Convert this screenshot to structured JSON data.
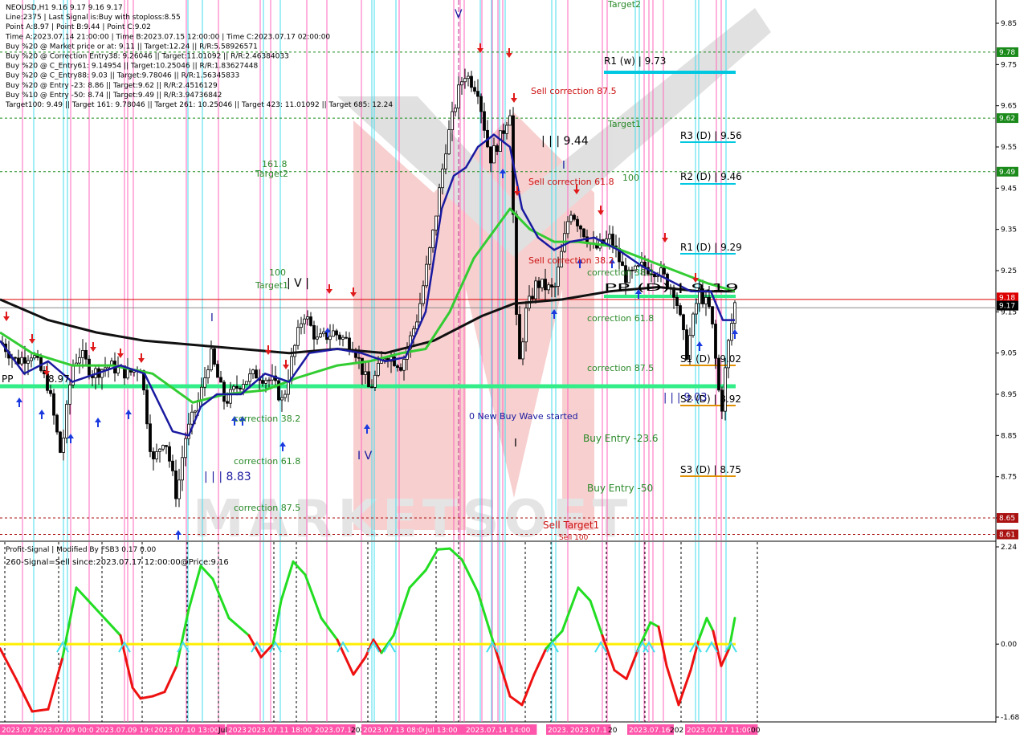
{
  "header": {
    "lines": [
      "NEOUSD,H1  9.16 9.17 9.16 9.17",
      "Line:2375 | Last Signal is:Buy with stoploss:8.55",
      "Point A:8.97 | Point B:9.44 | Point C:9.02",
      "Time A:2023.07.14 21:00:00 | Time B:2023.07.15 12:00:00 | Time C:2023.07.17 02:00:00",
      "Buy %20 @ Market price or at: 9.11 || Target:12.24 || R/R:5.58926571",
      "Buy %20 @ Correction Entry38: 9.26046 || Target:11.01092 || R/R:2.46384033",
      "Buy %20 @ C_Entry61: 9.14954 || Target:10.25046 || R/R:1.83627448",
      "Buy %20 @ C_Entry88: 9.03 || Target:9.78046 || R/R:1.56345833",
      "Buy %20 @ Entry -23: 8.86 || Target:9.62 || R/R:2.4516129",
      "Buy %10 @ Entry -50: 8.74 || Target:9.49 || R/R:3.94736842",
      "Target100: 9.49 || Target 161: 9.78046 || Target 261: 10.25046 || Target 423: 11.01092 || Target 685: 12.24"
    ]
  },
  "price_axis": {
    "ticks": [
      "9.85",
      "9.75",
      "9.65",
      "9.55",
      "9.45",
      "9.35",
      "9.25",
      "9.15",
      "9.05",
      "8.95",
      "8.85",
      "8.75",
      "8.65"
    ],
    "tags": [
      {
        "label": "9.78",
        "color": "#1a8a1a"
      },
      {
        "label": "9.62",
        "color": "#1a8a1a"
      },
      {
        "label": "9.49",
        "color": "#1a8a1a"
      },
      {
        "label": "9.18",
        "color": "#dd0000"
      },
      {
        "label": "9.17",
        "color": "#000000"
      },
      {
        "label": "8.65",
        "color": "#aa1111"
      },
      {
        "label": "8.61",
        "color": "#aa1111"
      }
    ]
  },
  "osc_axis": {
    "ticks": [
      "2.24",
      "0.00",
      "-1.68"
    ]
  },
  "time_axis": {
    "labels": [
      "2023.07.08",
      "2023.07.09 00:00",
      "2023.07.09 19:00",
      "2023.07.10 13:00",
      "Jul",
      "2023.07",
      "2023.07.11 18:00",
      "2023.07.1",
      "202",
      "2023.07.13 08:00",
      "Jul 13:00",
      "2023.07.14 14:00",
      "2023.07.15",
      "2023.07.1",
      "20",
      "2023.07.16",
      "202",
      "2023.07.17 11:00",
      ":00"
    ]
  },
  "levels": {
    "r1w": "R1 (w) | 9.73",
    "r3": "R3 (D) | 9.56",
    "r2": "R2 (D) | 9.46",
    "r1": "R1 (D) | 9.29",
    "pp": "PP (D) | 9.19",
    "s1": "S1 (D) | 9.02",
    "s2": "S2 (D) | 8.92",
    "s3": "S3 (D) | 8.75",
    "pp_left": "PP",
    "pp_left_val": "8.97"
  },
  "annotations": {
    "target2_top": "Target2",
    "target1_mid": "Target1",
    "n161": "161.8",
    "target2_left": "Target2",
    "n100_left": "100",
    "target1_left": "Target1",
    "wave_iiii": "| | | 9.44",
    "wave_iii": "| | | 8.83",
    "wave_iv": "I V",
    "wave_v": "V",
    "wave_ivi": "| V |",
    "wave_i": "I",
    "wave_iii_b": "| | | 9.03",
    "n100_mid": "100",
    "sell_corr_875": "Sell correction 87.5",
    "sell_corr_618": "Sell correction 61.8",
    "sell_corr_382": "Sell correction 38.2",
    "corr_382_mid": "correction 38.2",
    "corr_618_mid": "correction 61.8",
    "corr_875_mid": "correction 87.5",
    "corr_382_left": "correction 38.2",
    "corr_618_left": "correction 61.8",
    "corr_875_left": "correction 87.5",
    "new_wave": "0 New Buy Wave started",
    "buy_entry_23": "Buy Entry -23.6",
    "buy_entry_50": "Buy Entry -50",
    "sell_target1": "Sell Target1",
    "sell_100": "Sell 100"
  },
  "oscillator": {
    "title": "Profit-Signal | Modified By FSB3 0.17 0.00",
    "signal": "260-Signal=Sell since:2023.07.17 12:00:00@Price:9.16"
  },
  "colors": {
    "ma_fast": "#1a1aa0",
    "ma_slow": "#33cc33",
    "ma_200": "#111111",
    "pivot": "#00c8e0",
    "support": "#e09000",
    "bull_osc": "#22dd22",
    "bear_osc": "#ee1111",
    "pink_vline": "#ff66bb",
    "cyan_vline": "#44ddee"
  },
  "chart_data": [
    {
      "type": "candlestick",
      "title": "NEOUSD,H1",
      "ylim": [
        8.6,
        9.88
      ],
      "ohlc_path": [
        [
          0,
          9.08
        ],
        [
          20,
          9.03
        ],
        [
          40,
          9.05
        ],
        [
          60,
          8.97
        ],
        [
          76,
          8.8
        ],
        [
          90,
          9.02
        ],
        [
          100,
          9.05
        ],
        [
          115,
          9.0
        ],
        [
          135,
          9.02
        ],
        [
          160,
          9.0
        ],
        [
          175,
          9.02
        ],
        [
          190,
          8.78
        ],
        [
          205,
          8.85
        ],
        [
          220,
          8.7
        ],
        [
          230,
          8.84
        ],
        [
          250,
          8.95
        ],
        [
          262,
          9.05
        ],
        [
          280,
          8.93
        ],
        [
          300,
          8.98
        ],
        [
          320,
          9.0
        ],
        [
          340,
          8.98
        ],
        [
          352,
          8.93
        ],
        [
          365,
          9.05
        ],
        [
          378,
          9.15
        ],
        [
          395,
          9.08
        ],
        [
          415,
          9.1
        ],
        [
          440,
          9.07
        ],
        [
          460,
          8.96
        ],
        [
          480,
          9.05
        ],
        [
          500,
          9.02
        ],
        [
          520,
          9.14
        ],
        [
          540,
          9.35
        ],
        [
          555,
          9.55
        ],
        [
          570,
          9.68
        ],
        [
          578,
          9.73
        ],
        [
          595,
          9.69
        ],
        [
          610,
          9.52
        ],
        [
          625,
          9.58
        ],
        [
          635,
          9.64
        ],
        [
          645,
          9.0
        ],
        [
          655,
          9.15
        ],
        [
          668,
          9.22
        ],
        [
          690,
          9.2
        ],
        [
          710,
          9.4
        ],
        [
          725,
          9.35
        ],
        [
          740,
          9.3
        ],
        [
          760,
          9.33
        ],
        [
          780,
          9.23
        ],
        [
          800,
          9.26
        ],
        [
          820,
          9.25
        ],
        [
          840,
          9.2
        ],
        [
          855,
          9.05
        ],
        [
          870,
          9.2
        ],
        [
          885,
          9.15
        ],
        [
          898,
          8.9
        ],
        [
          905,
          9.05
        ],
        [
          915,
          9.17
        ]
      ],
      "ma_fast": [
        [
          0,
          9.08
        ],
        [
          30,
          9.0
        ],
        [
          60,
          9.03
        ],
        [
          90,
          8.98
        ],
        [
          120,
          9.0
        ],
        [
          150,
          9.02
        ],
        [
          180,
          9.0
        ],
        [
          200,
          8.92
        ],
        [
          215,
          8.86
        ],
        [
          235,
          8.85
        ],
        [
          250,
          8.92
        ],
        [
          270,
          8.95
        ],
        [
          300,
          8.95
        ],
        [
          330,
          9.0
        ],
        [
          360,
          8.98
        ],
        [
          385,
          9.05
        ],
        [
          420,
          9.06
        ],
        [
          450,
          9.05
        ],
        [
          480,
          9.03
        ],
        [
          505,
          9.04
        ],
        [
          530,
          9.15
        ],
        [
          550,
          9.4
        ],
        [
          565,
          9.48
        ],
        [
          580,
          9.5
        ],
        [
          595,
          9.55
        ],
        [
          615,
          9.58
        ],
        [
          635,
          9.55
        ],
        [
          650,
          9.4
        ],
        [
          670,
          9.33
        ],
        [
          690,
          9.3
        ],
        [
          710,
          9.32
        ],
        [
          740,
          9.33
        ],
        [
          770,
          9.3
        ],
        [
          800,
          9.26
        ],
        [
          830,
          9.23
        ],
        [
          860,
          9.2
        ],
        [
          885,
          9.2
        ],
        [
          900,
          9.13
        ],
        [
          915,
          9.13
        ]
      ],
      "ma_slow": [
        [
          0,
          9.1
        ],
        [
          40,
          9.05
        ],
        [
          90,
          9.02
        ],
        [
          140,
          9.02
        ],
        [
          190,
          9.0
        ],
        [
          240,
          8.93
        ],
        [
          280,
          8.95
        ],
        [
          330,
          8.96
        ],
        [
          370,
          8.99
        ],
        [
          420,
          9.02
        ],
        [
          460,
          9.03
        ],
        [
          500,
          9.05
        ],
        [
          530,
          9.06
        ],
        [
          560,
          9.15
        ],
        [
          590,
          9.28
        ],
        [
          620,
          9.36
        ],
        [
          635,
          9.4
        ],
        [
          660,
          9.35
        ],
        [
          690,
          9.32
        ],
        [
          720,
          9.32
        ],
        [
          760,
          9.31
        ],
        [
          800,
          9.28
        ],
        [
          840,
          9.25
        ],
        [
          880,
          9.22
        ],
        [
          915,
          9.2
        ]
      ],
      "ma_200": [
        [
          0,
          9.18
        ],
        [
          60,
          9.13
        ],
        [
          120,
          9.1
        ],
        [
          180,
          9.08
        ],
        [
          240,
          9.07
        ],
        [
          300,
          9.06
        ],
        [
          360,
          9.05
        ],
        [
          420,
          9.06
        ],
        [
          480,
          9.05
        ],
        [
          540,
          9.08
        ],
        [
          600,
          9.14
        ],
        [
          640,
          9.17
        ],
        [
          700,
          9.18
        ],
        [
          760,
          9.2
        ],
        [
          820,
          9.21
        ],
        [
          870,
          9.2
        ],
        [
          915,
          9.2
        ]
      ],
      "oscillator": {
        "ylim": [
          -1.68,
          2.24
        ],
        "path": [
          [
            0,
            -0.1
          ],
          [
            20,
            -0.8
          ],
          [
            40,
            -1.55
          ],
          [
            60,
            -1.5
          ],
          [
            78,
            -0.3
          ],
          [
            95,
            1.3
          ],
          [
            110,
            1.0
          ],
          [
            130,
            0.6
          ],
          [
            150,
            0.2
          ],
          [
            165,
            -1.0
          ],
          [
            175,
            -1.25
          ],
          [
            190,
            -1.2
          ],
          [
            205,
            -1.1
          ],
          [
            220,
            -0.5
          ],
          [
            235,
            0.8
          ],
          [
            250,
            1.8
          ],
          [
            265,
            1.5
          ],
          [
            285,
            0.6
          ],
          [
            310,
            0.2
          ],
          [
            325,
            -0.3
          ],
          [
            340,
            0.0
          ],
          [
            350,
            1.0
          ],
          [
            365,
            1.9
          ],
          [
            380,
            1.6
          ],
          [
            400,
            0.6
          ],
          [
            420,
            0.1
          ],
          [
            440,
            -0.7
          ],
          [
            455,
            -0.3
          ],
          [
            465,
            0.1
          ],
          [
            475,
            -0.2
          ],
          [
            490,
            0.2
          ],
          [
            510,
            1.3
          ],
          [
            530,
            1.7
          ],
          [
            545,
            2.18
          ],
          [
            560,
            2.2
          ],
          [
            575,
            1.95
          ],
          [
            595,
            1.2
          ],
          [
            615,
            0.0
          ],
          [
            635,
            -1.2
          ],
          [
            650,
            -1.4
          ],
          [
            665,
            -0.7
          ],
          [
            680,
            -0.1
          ],
          [
            700,
            0.3
          ],
          [
            720,
            1.3
          ],
          [
            735,
            1.0
          ],
          [
            750,
            0.2
          ],
          [
            765,
            -0.6
          ],
          [
            780,
            -0.8
          ],
          [
            795,
            -0.1
          ],
          [
            810,
            0.5
          ],
          [
            820,
            0.4
          ],
          [
            830,
            -0.5
          ],
          [
            845,
            -1.4
          ],
          [
            860,
            -0.6
          ],
          [
            870,
            0.1
          ],
          [
            880,
            0.6
          ],
          [
            888,
            0.3
          ],
          [
            898,
            -0.5
          ],
          [
            908,
            -0.1
          ],
          [
            915,
            0.6
          ]
        ]
      }
    }
  ]
}
